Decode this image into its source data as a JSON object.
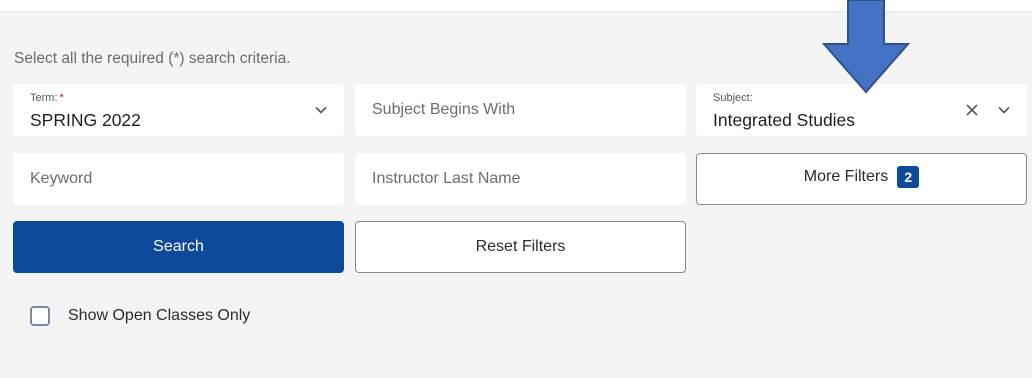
{
  "instructions": "Select all the required (*) search criteria.",
  "term": {
    "label": "Term:",
    "required_mark": "*",
    "value": "SPRING 2022"
  },
  "subject_begins_with": {
    "placeholder": "Subject Begins With"
  },
  "subject": {
    "label": "Subject:",
    "value": "Integrated Studies"
  },
  "keyword": {
    "placeholder": "Keyword"
  },
  "instructor": {
    "placeholder": "Instructor Last Name"
  },
  "more_filters": {
    "label": "More Filters",
    "count": "2"
  },
  "search_button": {
    "label": "Search"
  },
  "reset_button": {
    "label": "Reset Filters"
  },
  "open_classes": {
    "label": "Show Open Classes Only",
    "checked": false
  },
  "colors": {
    "primary": "#0d4a9b",
    "arrow_fill": "#4472c4",
    "arrow_stroke": "#2f528f",
    "required": "#c8102e"
  },
  "icons": [
    "chevron-down-icon",
    "clear-x-icon",
    "down-arrow-annotation"
  ]
}
